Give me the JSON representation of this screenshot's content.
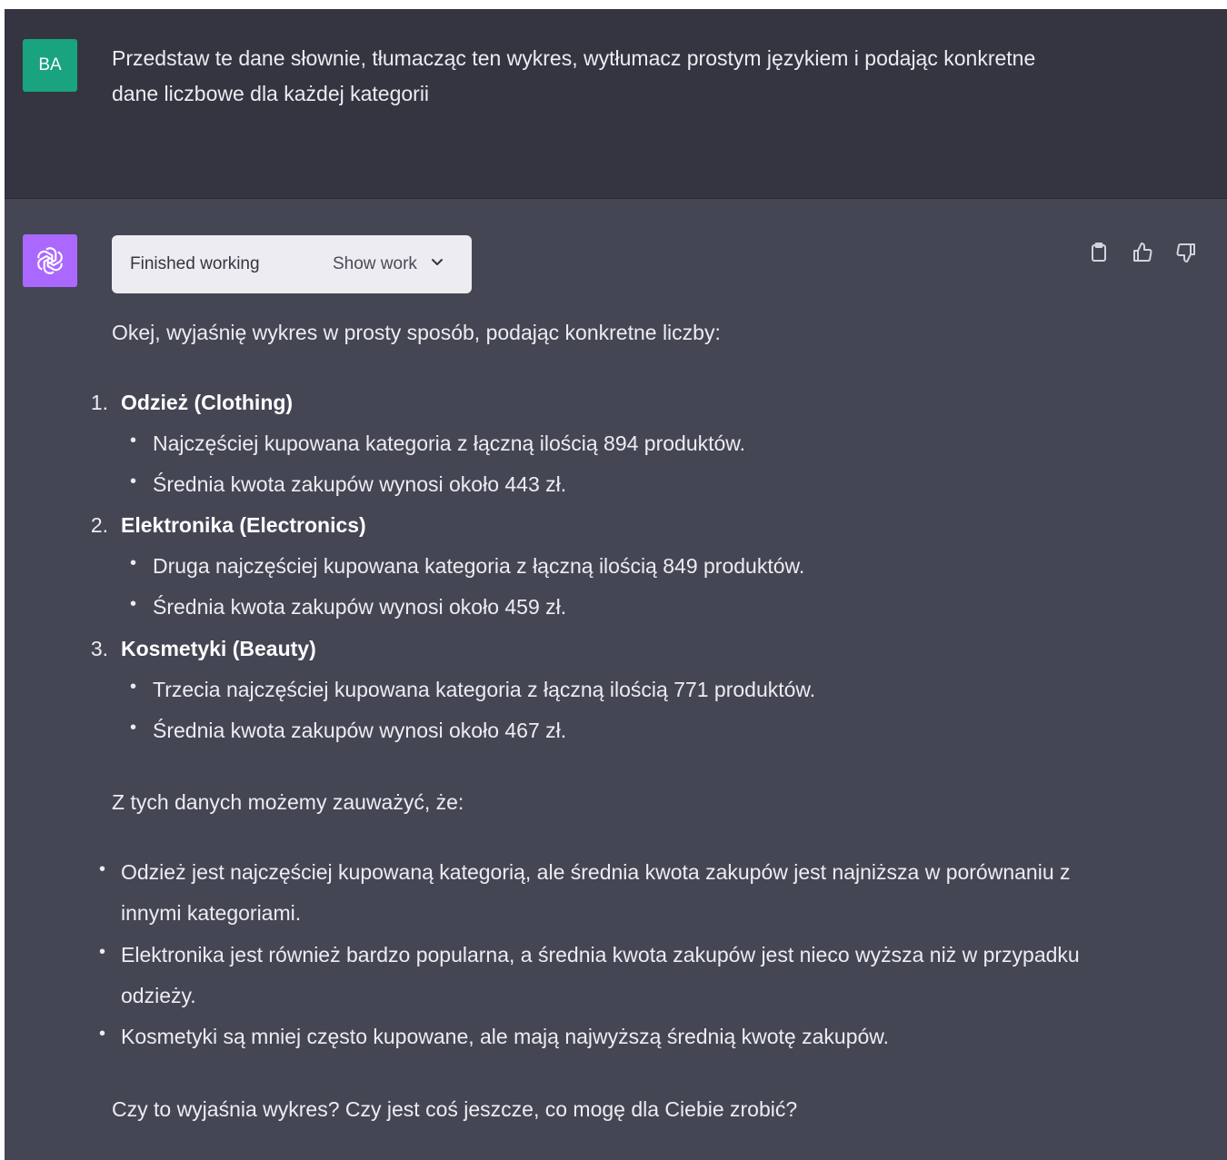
{
  "user": {
    "avatar_initials": "BA",
    "message": "Przedstaw te dane słownie, tłumacząc ten wykres, wytłumacz prostym językiem i podając konkretne dane liczbowe dla każdej kategorii"
  },
  "assistant": {
    "avatar_icon": "openai-logo-icon",
    "work": {
      "status": "Finished working",
      "toggle_label": "Show work"
    },
    "actions": [
      "clipboard-icon",
      "thumbs-up-icon",
      "thumbs-down-icon"
    ],
    "intro": "Okej, wyjaśnię wykres w prosty sposób, podając konkretne liczby:",
    "categories": [
      {
        "number": "1.",
        "title": "Odzież (Clothing)",
        "bullets": [
          "Najczęściej kupowana kategoria z łączną ilością 894 produktów.",
          "Średnia kwota zakupów wynosi około 443 zł."
        ]
      },
      {
        "number": "2.",
        "title": "Elektronika (Electronics)",
        "bullets": [
          "Druga najczęściej kupowana kategoria z łączną ilością 849 produktów.",
          "Średnia kwota zakupów wynosi około 459 zł."
        ]
      },
      {
        "number": "3.",
        "title": "Kosmetyki (Beauty)",
        "bullets": [
          "Trzecia najczęściej kupowana kategoria z łączną ilością 771 produktów.",
          "Średnia kwota zakupów wynosi około 467 zł."
        ]
      }
    ],
    "observations_intro": "Z tych danych możemy zauważyć, że:",
    "observations": [
      "Odzież jest najczęściej kupowaną kategorią, ale średnia kwota zakupów jest najniższa w porównaniu z innymi kategoriami.",
      "Elektronika jest również bardzo popularna, a średnia kwota zakupów jest nieco wyższa niż w przypadku odzieży.",
      "Kosmetyki są mniej często kupowane, ale mają najwyższą średnią kwotę zakupów."
    ],
    "closing": "Czy to wyjaśnia wykres? Czy jest coś jeszcze, co mogę dla Ciebie zrobić?"
  },
  "colors": {
    "user_bg": "#343541",
    "assistant_bg": "#444654",
    "user_avatar": "#19a37f",
    "assistant_avatar": "#ab68ff",
    "text": "#ececf1"
  }
}
